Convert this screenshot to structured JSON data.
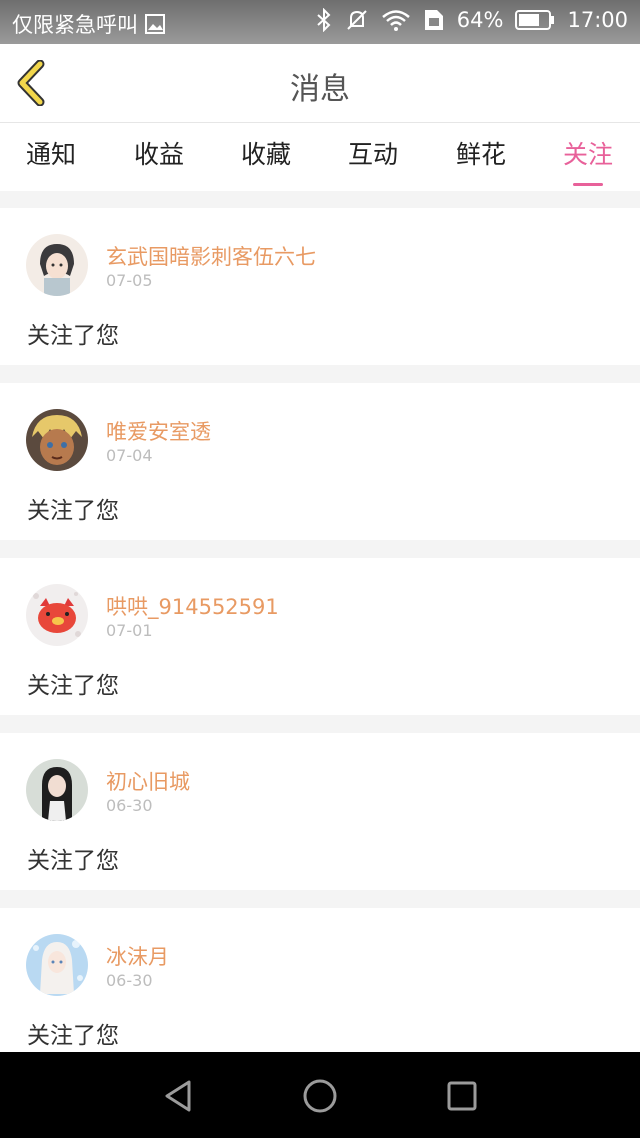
{
  "status_bar": {
    "carrier": "仅限紧急呼叫",
    "battery": "64%",
    "time": "17:00",
    "icons": [
      "image-icon",
      "bluetooth-icon",
      "mute-icon",
      "wifi-icon",
      "sim-icon",
      "battery-icon"
    ]
  },
  "header": {
    "title": "消息",
    "back_icon": "chevron-left-icon"
  },
  "tabs": [
    {
      "label": "通知"
    },
    {
      "label": "收益"
    },
    {
      "label": "收藏"
    },
    {
      "label": "互动"
    },
    {
      "label": "鲜花"
    },
    {
      "label": "关注",
      "active": true
    }
  ],
  "messages": [
    {
      "name": "玄武国暗影刺客伍六七",
      "date": "07-05",
      "text": "关注了您",
      "avatar": "anime-girl-avatar"
    },
    {
      "name": "唯爱安室透",
      "date": "07-04",
      "text": "关注了您",
      "avatar": "anime-boy-avatar"
    },
    {
      "name": "哄哄_914552591",
      "date": "07-01",
      "text": "关注了您",
      "avatar": "red-pig-avatar"
    },
    {
      "name": "初心旧城",
      "date": "06-30",
      "text": "关注了您",
      "avatar": "girl-photo-avatar"
    },
    {
      "name": "冰沫月",
      "date": "06-30",
      "text": "关注了您",
      "avatar": "anime-blue-avatar"
    }
  ],
  "nav_bar": {
    "icons": [
      "back-triangle-icon",
      "home-circle-icon",
      "recents-square-icon"
    ]
  },
  "colors": {
    "accent": "#e8619a",
    "name": "#e89a63",
    "back_arrow": "#f2d74c"
  }
}
